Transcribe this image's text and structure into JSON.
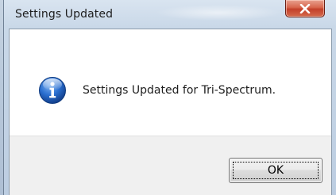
{
  "window": {
    "title": "Settings Updated",
    "close_icon": "close-icon"
  },
  "dialog": {
    "icon": "info-icon",
    "message": "Settings Updated for Tri-Spectrum.",
    "ok_label": "OK"
  },
  "colors": {
    "close_button": "#c3402a",
    "info_icon": "#1f5fbf",
    "footer": "#f0f0f0"
  }
}
